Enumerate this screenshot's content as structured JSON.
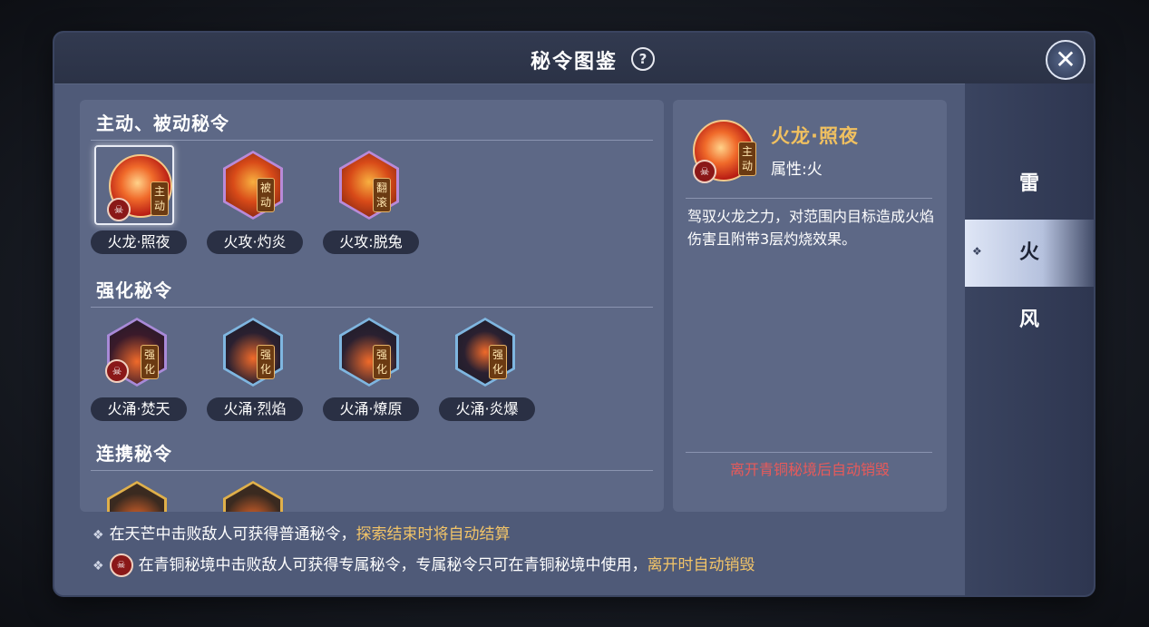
{
  "dialog": {
    "title": "秘令图鉴",
    "help_icon": "?",
    "close_icon": "✕"
  },
  "sections": [
    {
      "title": "主动、被动秘令",
      "cards": [
        {
          "label": "火龙·照夜",
          "tag": "主动",
          "icon": "fire-dragon-icon",
          "exclusive": true,
          "selected": true
        },
        {
          "label": "火攻·灼炎",
          "tag": "被动",
          "icon": "fire-attack-icon",
          "exclusive": false
        },
        {
          "label": "火攻:脱兔",
          "tag": "翻滚",
          "icon": "fire-roll-icon",
          "exclusive": false
        }
      ]
    },
    {
      "title": "强化秘令",
      "cards": [
        {
          "label": "火涌·焚天",
          "tag": "强化",
          "icon": "flame-up-icon",
          "exclusive": true
        },
        {
          "label": "火涌·烈焰",
          "tag": "强化",
          "icon": "flame-pillar-icon",
          "exclusive": false
        },
        {
          "label": "火涌·燎原",
          "tag": "强化",
          "icon": "flame-spread-icon",
          "exclusive": false
        },
        {
          "label": "火涌·炎爆",
          "tag": "强化",
          "icon": "flame-burst-icon",
          "exclusive": false
        }
      ]
    },
    {
      "title": "连携秘令"
    }
  ],
  "detail": {
    "name": "火龙·照夜",
    "tag": "主动",
    "attribute": "属性:火",
    "description": "驾驭火龙之力，对范围内目标造成火焰伤害且附带3层灼烧效果。",
    "warning": "离开青铜秘境后自动销毁"
  },
  "tabs": [
    {
      "label": "雷",
      "active": false
    },
    {
      "label": "火",
      "active": true
    },
    {
      "label": "风",
      "active": false
    }
  ],
  "footer": {
    "line1_prefix": "在天芒中击败敌人可获得普通秘令，",
    "line1_highlight": "探索结束时将自动结算",
    "line2_prefix": "在青铜秘境中击败敌人可获得专属秘令，专属秘令只可在青铜秘境中使用，",
    "line2_highlight": "离开时自动销毁"
  },
  "colors": {
    "accent_gold": "#f2c468",
    "warning_red": "#e85a5a",
    "panel": "#5d6886"
  }
}
